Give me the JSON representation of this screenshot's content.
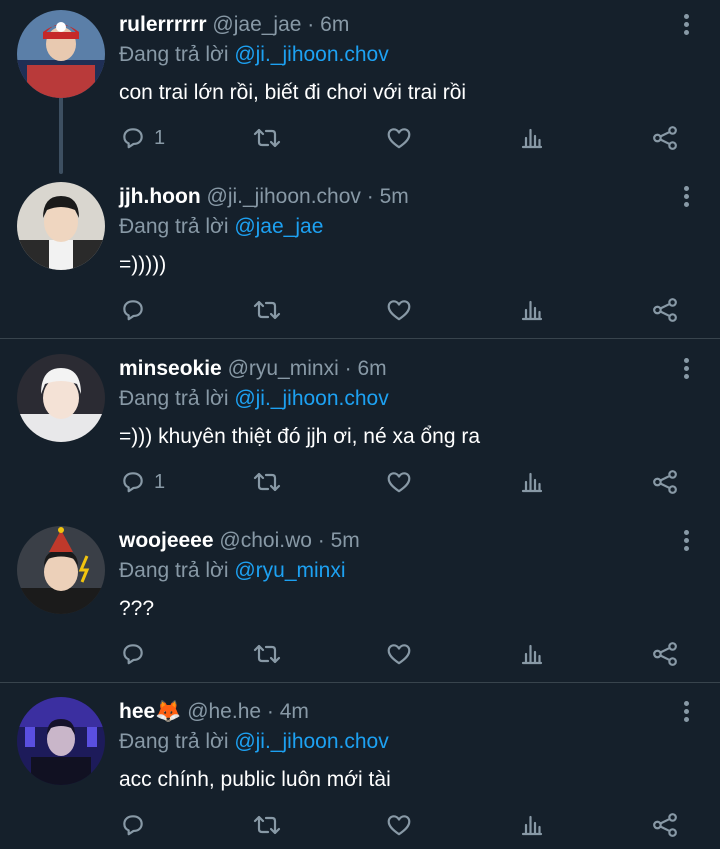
{
  "reply_prefix": "Đang trả lời",
  "colors": {
    "background": "#15202b",
    "text": "#ffffff",
    "muted": "#8899a6",
    "mention": "#1da1f2",
    "divider": "#38444d"
  },
  "tweets": [
    {
      "name": "rulerrrrrr",
      "handle": "@jae_jae",
      "dot": "·",
      "time": "6m",
      "reply_to": "@ji._jihoon.chov",
      "text": "con trai lớn rồi, biết đi chơi với trai rồi",
      "reply_count": "1",
      "avatar_icon": "avatar-photo"
    },
    {
      "name": "jjh.hoon",
      "handle": "@ji._jihoon.chov",
      "dot": "·",
      "time": "5m",
      "reply_to": "@jae_jae",
      "text": "=)))))",
      "reply_count": "",
      "avatar_icon": "avatar-photo"
    },
    {
      "name": "minseokie",
      "handle": "@ryu_minxi",
      "dot": "·",
      "time": "6m",
      "reply_to": "@ji._jihoon.chov",
      "text": "=))) khuyên thiệt đó jjh ơi, né xa ổng ra",
      "reply_count": "1",
      "avatar_icon": "avatar-photo"
    },
    {
      "name": "woojeeee",
      "handle": "@choi.wo",
      "dot": "·",
      "time": "5m",
      "reply_to": "@ryu_minxi",
      "text": "???",
      "reply_count": "",
      "avatar_icon": "avatar-photo"
    },
    {
      "name": "hee🦊",
      "handle": "@he.he",
      "dot": "·",
      "time": "4m",
      "reply_to": "@ji._jihoon.chov",
      "text": "acc chính, public luôn mới tài",
      "reply_count": "",
      "avatar_icon": "avatar-photo"
    }
  ],
  "action_icons": [
    "reply-icon",
    "retweet-icon",
    "like-icon",
    "analytics-icon",
    "share-icon"
  ]
}
